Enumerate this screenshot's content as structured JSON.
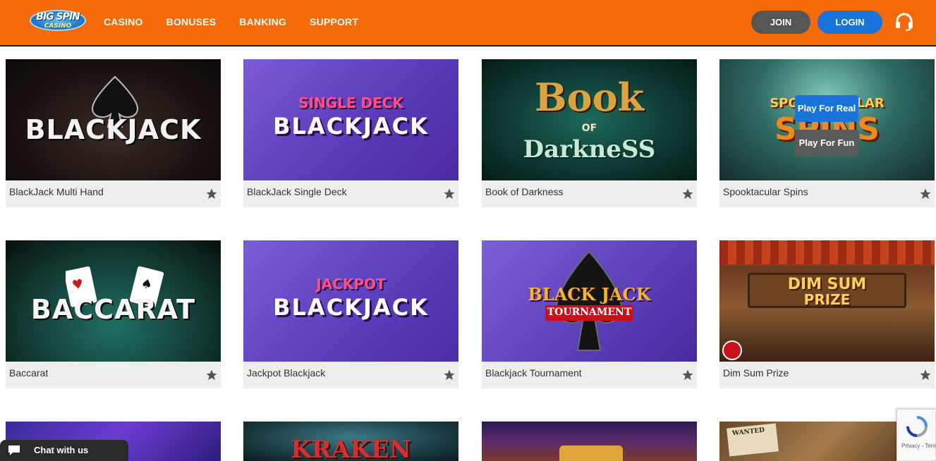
{
  "header": {
    "logo": {
      "line1": "BIG SPIN",
      "line2": "CASINO"
    },
    "nav": [
      "CASINO",
      "BONUSES",
      "BANKING",
      "SUPPORT"
    ],
    "join_label": "JOIN",
    "login_label": "LOGIN",
    "support_icon": "headset-icon"
  },
  "colors": {
    "header_bg": "#f56a0b",
    "join_bg": "#555555",
    "login_bg": "#1a73d9",
    "tile_bar_bg": "#eeeeee",
    "play_real_bg": "#1a73d9"
  },
  "games": [
    {
      "name": "BlackJack Multi Hand",
      "art": "BLACKJACK",
      "art_sub": ""
    },
    {
      "name": "BlackJack Single Deck",
      "art": "BLACKJACK",
      "art_sub": "SINGLE DECK"
    },
    {
      "name": "Book of Darkness",
      "art": "Book",
      "art_sub": "OF",
      "art_sub2": "DarkneSS"
    },
    {
      "name": "Spooktacular Spins",
      "art": "SPINS",
      "art_sub": "SPOOKTACULAR"
    },
    {
      "name": "Baccarat",
      "art": "BACCARAT",
      "art_sub": ""
    },
    {
      "name": "Jackpot Blackjack",
      "art": "BLACKJACK",
      "art_sub": "JACKPOT"
    },
    {
      "name": "Blackjack Tournament",
      "art": "BLACK JACK",
      "art_sub": "TOURNAMENT"
    },
    {
      "name": "Dim Sum Prize",
      "art": "DIM SUM",
      "art_sub": "PRIZE"
    },
    {
      "name": "",
      "art": "",
      "art_sub": ""
    },
    {
      "name": "",
      "art": "KRAKEN",
      "art_sub": ""
    },
    {
      "name": "",
      "art": "",
      "art_sub": ""
    },
    {
      "name": "",
      "art": "",
      "art_sub": "WANTED"
    }
  ],
  "hover_overlay": {
    "play_real": "Play For Real",
    "play_fun": "Play For Fun"
  },
  "favorite_icon": "star-icon",
  "chat": {
    "label": "Chat with us",
    "icon": "chat-bubble-icon"
  },
  "recaptcha": {
    "text": "Privacy - Terms"
  }
}
